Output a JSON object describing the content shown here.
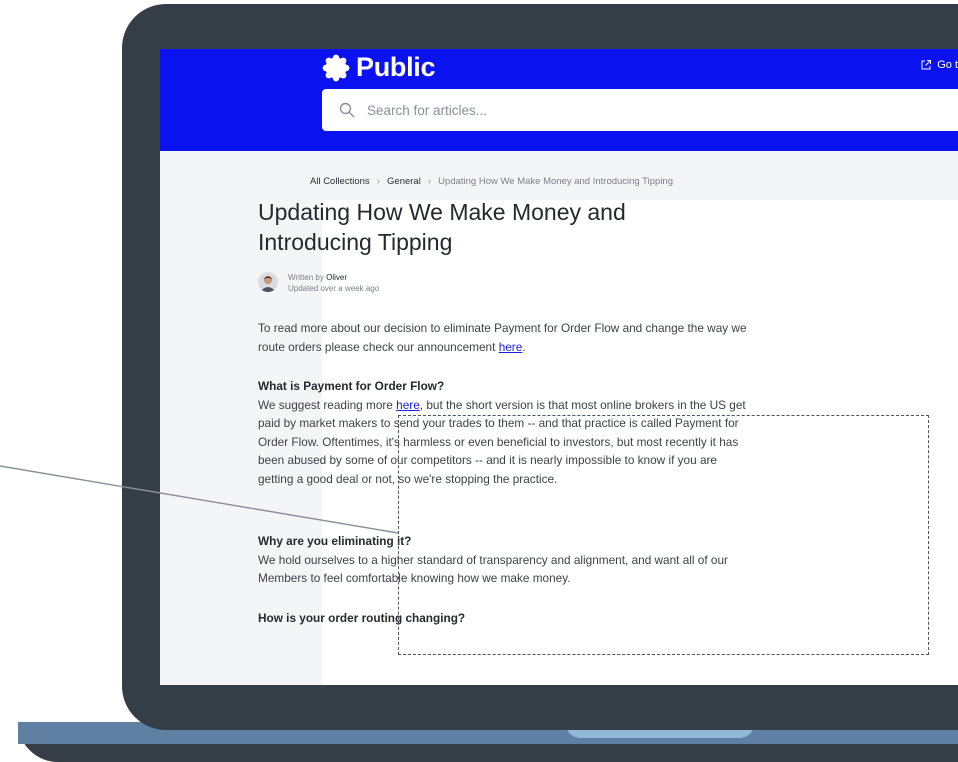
{
  "brand": {
    "name": "Public",
    "goto_label": "Go t"
  },
  "search": {
    "placeholder": "Search for articles..."
  },
  "breadcrumb": {
    "items": [
      "All Collections",
      "General"
    ],
    "current": "Updating How We Make Money and Introducing Tipping"
  },
  "article": {
    "title": "Updating How We Make Money and Introducing Tipping",
    "author": {
      "written_by": "Written by",
      "name": "Oliver",
      "updated": "Updated over a week ago"
    },
    "intro": {
      "text": "To read more about our decision to eliminate Payment for Order Flow and change the way we route orders please check our announcement ",
      "link_text": "here",
      "after": "."
    },
    "sections": [
      {
        "heading": "What is Payment for Order Flow?",
        "before": "We suggest reading more ",
        "link_text": "here",
        "after": ", but the short version is that most online brokers in the US get paid by market makers to send your trades to them -- and that practice is called Payment for Order Flow. Oftentimes, it's harmless or even beneficial to investors, but most recently it has been abused by some of our competitors -- and it is nearly impossible to know if you are getting a good deal or not, so we're stopping the practice."
      },
      {
        "heading": "Why are you eliminating it?",
        "text": "We hold ourselves to a higher standard of transparency and alignment, and want all of our Members to feel comfortable knowing how we make money."
      },
      {
        "heading": "How is your order routing changing?"
      }
    ]
  },
  "colors": {
    "brand_blue": "#0a12f0",
    "device_frame": "#353d46",
    "link": "#1a1fe3"
  }
}
